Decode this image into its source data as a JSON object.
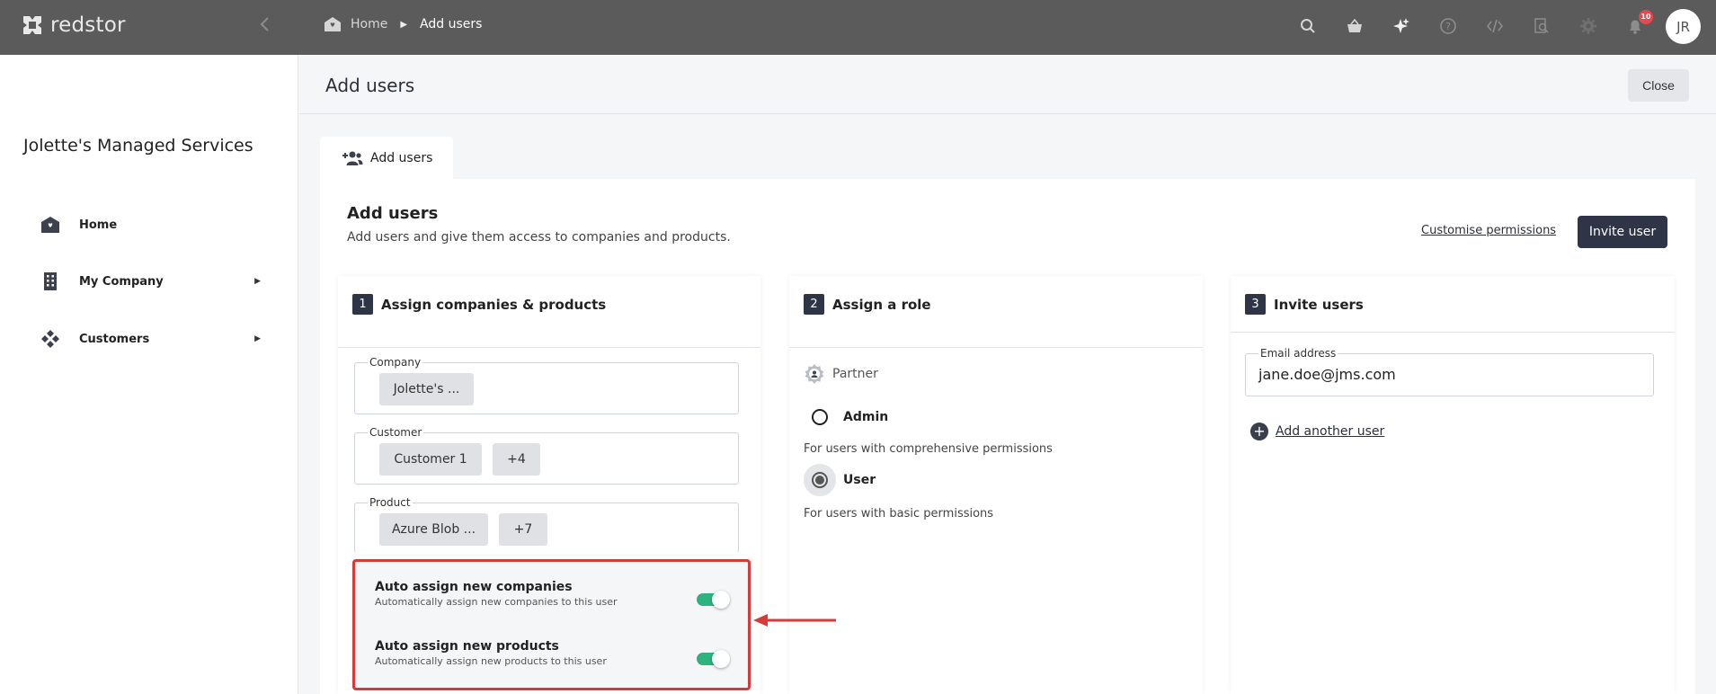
{
  "topbar": {
    "brand": "redstor",
    "breadcrumb": {
      "home": "Home",
      "current": "Add users"
    },
    "notification_count": "10",
    "avatar_initials": "JR"
  },
  "sidebar": {
    "org_name": "Jolette's Managed Services",
    "items": [
      {
        "label": "Home",
        "icon": "home-icon",
        "has_submenu": false
      },
      {
        "label": "My Company",
        "icon": "building-icon",
        "has_submenu": true
      },
      {
        "label": "Customers",
        "icon": "customers-icon",
        "has_submenu": true
      }
    ]
  },
  "page": {
    "title": "Add users",
    "close_label": "Close",
    "tab_label": "Add users"
  },
  "card": {
    "title": "Add users",
    "subtitle": "Add users and give them access to companies and products.",
    "customise_link": "Customise permissions",
    "invite_button": "Invite user"
  },
  "step1": {
    "number": "1",
    "title": "Assign companies & products",
    "company": {
      "label": "Company",
      "chips": [
        "Jolette's ..."
      ]
    },
    "customer": {
      "label": "Customer",
      "chips": [
        "Customer 1",
        "+4"
      ]
    },
    "product": {
      "label": "Product",
      "chips": [
        "Azure Blob ...",
        "+7"
      ]
    },
    "toggles": [
      {
        "title": "Auto assign new companies",
        "desc": "Automatically assign new companies to this user",
        "on": true
      },
      {
        "title": "Auto assign new products",
        "desc": "Automatically assign new products to this user",
        "on": true
      }
    ]
  },
  "step2": {
    "number": "2",
    "title": "Assign a role",
    "group_label": "Partner",
    "roles": [
      {
        "label": "Admin",
        "desc": "For users with comprehensive permissions",
        "selected": false
      },
      {
        "label": "User",
        "desc": "For users with basic permissions",
        "selected": true
      }
    ]
  },
  "step3": {
    "number": "3",
    "title": "Invite users",
    "email_label": "Email address",
    "email_value": "jane.doe@jms.com",
    "add_another": "Add another user"
  },
  "colors": {
    "topbar": "#5b5b5b",
    "primary_button": "#2e3547",
    "toggle_on": "#2eb37e",
    "highlight_box": "#d83a3a",
    "badge": "#e5484d"
  }
}
